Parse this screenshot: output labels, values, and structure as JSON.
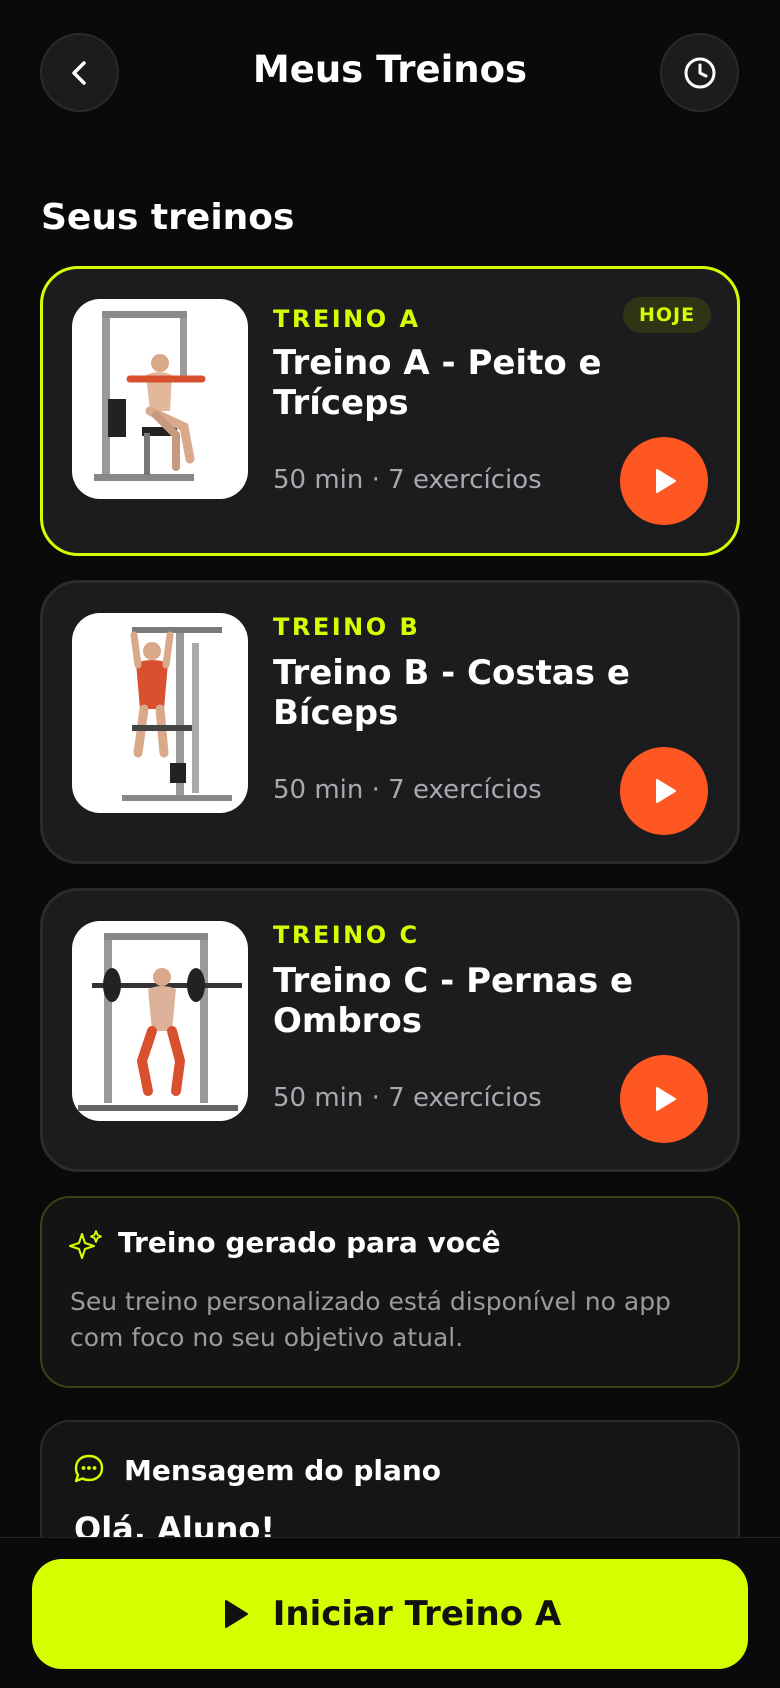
{
  "header": {
    "title": "Meus Treinos",
    "back_icon": "chevron-left-icon",
    "history_icon": "clock-icon"
  },
  "section_title": "Seus treinos",
  "workouts": [
    {
      "tag": "TREINO A",
      "title": "Treino A - Peito e Tríceps",
      "meta": "50 min · 7 exercícios",
      "badge": "HOJE",
      "active": true,
      "image": "chest-press-machine-illustration"
    },
    {
      "tag": "TREINO B",
      "title": "Treino B - Costas e Bíceps",
      "meta": "50 min · 7 exercícios",
      "active": false,
      "image": "pull-up-station-illustration"
    },
    {
      "tag": "TREINO C",
      "title": "Treino C - Pernas e Ombros",
      "meta": "50 min · 7 exercícios",
      "active": false,
      "image": "smith-machine-squat-illustration"
    }
  ],
  "generated": {
    "title": "Treino gerado para você",
    "text": "Seu treino personalizado está disponível no app com foco no seu objetivo atual.",
    "icon": "sparkles-icon"
  },
  "plan_message": {
    "title": "Mensagem do plano",
    "greeting": "Olá, Aluno!",
    "icon": "chat-bubble-icon"
  },
  "cta": {
    "label": "Iniciar Treino A",
    "icon": "play-icon"
  },
  "colors": {
    "accent": "#d4ff00",
    "play": "#ff5722",
    "background": "#0a0a0a",
    "card": "#1c1c1e"
  }
}
